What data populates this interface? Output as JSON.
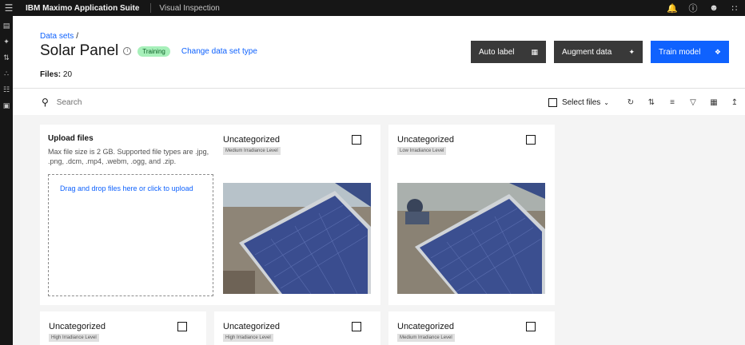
{
  "topbar": {
    "brand": "IBM Maximo Application Suite",
    "product": "Visual Inspection"
  },
  "header": {
    "breadcrumb": "Data sets",
    "breadcrumb_sep": "/",
    "title": "Solar Panel",
    "status_tag": "Training",
    "change_link": "Change data set type",
    "files_label": "Files:",
    "files_count": "20"
  },
  "actions": {
    "auto_label": "Auto label",
    "augment": "Augment data",
    "train": "Train model"
  },
  "toolbar": {
    "search_placeholder": "Search",
    "select_files": "Select files"
  },
  "upload": {
    "title": "Upload files",
    "description": "Max file size is 2 GB. Supported file types are .jpg, .png, .dcm, .mp4, .webm, .ogg, and .zip.",
    "dropzone_text": "Drag and drop files here or click to upload"
  },
  "cards": [
    {
      "title": "Uncategorized",
      "tag": "Medium Irradiance Level"
    },
    {
      "title": "Uncategorized",
      "tag": "Low Irradiance Level"
    },
    {
      "title": "Uncategorized",
      "tag": "High Irradiance Level"
    },
    {
      "title": "Uncategorized",
      "tag": "High Irradiance Level"
    },
    {
      "title": "Uncategorized",
      "tag": "Medium Irradiance Level"
    }
  ],
  "colors": {
    "accent": "#0f62fe",
    "dark_button": "#393939",
    "topbar": "#161616",
    "training_tag_bg": "#a7f0ba",
    "training_tag_text": "#0e6027"
  },
  "icons": [
    "menu-icon",
    "notification-icon",
    "help-icon",
    "user-icon",
    "switcher-icon",
    "search-icon",
    "refresh-icon",
    "sort-icon",
    "filter-icon",
    "grid-view-icon",
    "upload-icon"
  ]
}
